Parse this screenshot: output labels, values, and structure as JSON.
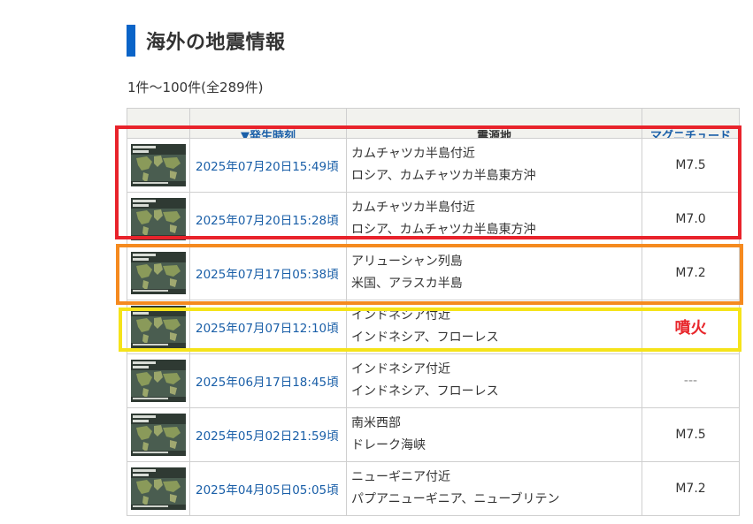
{
  "page": {
    "title": "海外の地震情報",
    "count_text": "1件～100件(全289件)"
  },
  "table": {
    "headers": {
      "thumb": "",
      "time": "▼発生時刻",
      "place": "震源地",
      "magnitude": "マグニチュード"
    },
    "rows": [
      {
        "time": "2025年07月20日15:49頃",
        "place1": "カムチャツカ半島付近",
        "place2": "ロシア、カムチャツカ半島東方沖",
        "magnitude": "M7.5"
      },
      {
        "time": "2025年07月20日15:28頃",
        "place1": "カムチャツカ半島付近",
        "place2": "ロシア、カムチャツカ半島東方沖",
        "magnitude": "M7.0"
      },
      {
        "time": "2025年07月17日05:38頃",
        "place1": "アリューシャン列島",
        "place2": "米国、アラスカ半島",
        "magnitude": "M7.2"
      },
      {
        "time": "2025年07月07日12:10頃",
        "place1": "インドネシア付近",
        "place2": "インドネシア、フローレス",
        "magnitude": "噴火"
      },
      {
        "time": "2025年06月17日18:45頃",
        "place1": "インドネシア付近",
        "place2": "インドネシア、フローレス",
        "magnitude": "---"
      },
      {
        "time": "2025年05月02日21:59頃",
        "place1": "南米西部",
        "place2": "ドレーク海峡",
        "magnitude": "M7.5"
      },
      {
        "time": "2025年04月05日05:05頃",
        "place1": "ニューギニア付近",
        "place2": "パプアニューギニア、ニューブリテン",
        "magnitude": "M7.2"
      }
    ]
  },
  "annotations": {
    "red_box_color": "#e8232b",
    "orange_box_color": "#f58a1f",
    "yellow_box_color": "#f5e31a"
  },
  "colors": {
    "accent": "#0a64c8",
    "link": "#1a5fa8",
    "eruption": "#e8262b"
  }
}
